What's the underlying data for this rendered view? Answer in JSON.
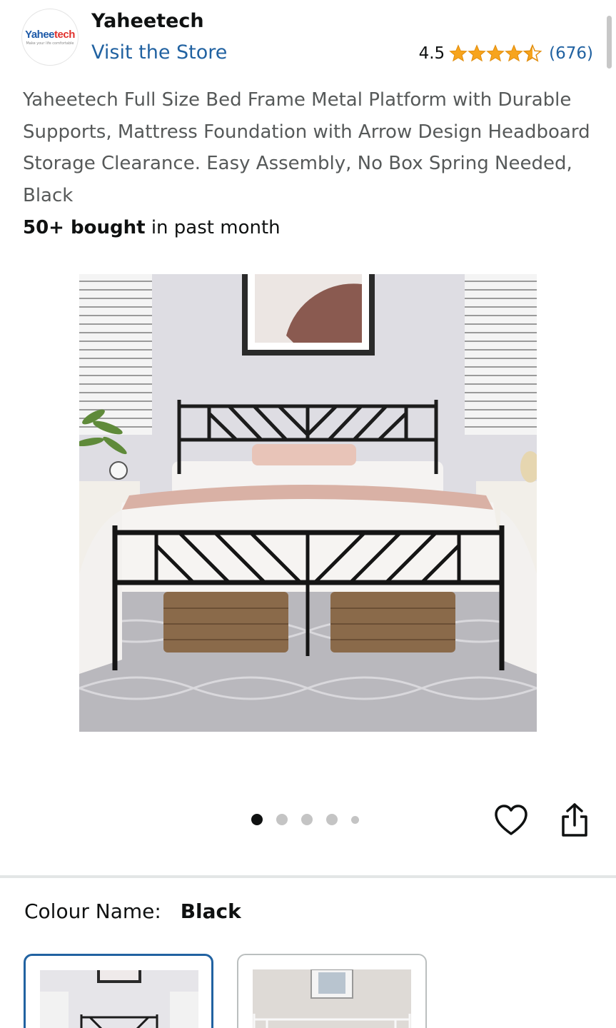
{
  "brand": {
    "logo_text_a": "Yahee",
    "logo_text_b": "tech",
    "logo_tagline": "Make your life comfortable",
    "name": "Yaheetech",
    "store_link": "Visit the Store"
  },
  "rating": {
    "score": "4.5",
    "stars": 4.5,
    "count": "(676)",
    "star_color": "#f7a41d"
  },
  "product": {
    "title": "Yaheetech Full Size Bed Frame Metal Platform with Durable Supports, Mattress Foundation with Arrow Design Headboard Storage Clearance. Easy Assembly, No Box Spring Needed, Black",
    "bought_bold": "50+ bought",
    "bought_rest": " in past month"
  },
  "gallery": {
    "image_count": 5,
    "active_index": 0
  },
  "actions": {
    "wishlist_icon": "heart-icon",
    "share_icon": "share-icon"
  },
  "variant": {
    "label": "Colour Name:",
    "value": "Black",
    "options": [
      "Black",
      "White"
    ],
    "selected_border_color": "#2162a1"
  },
  "colors": {
    "link": "#2162a1",
    "text": "#0f1111",
    "muted": "#565959"
  }
}
